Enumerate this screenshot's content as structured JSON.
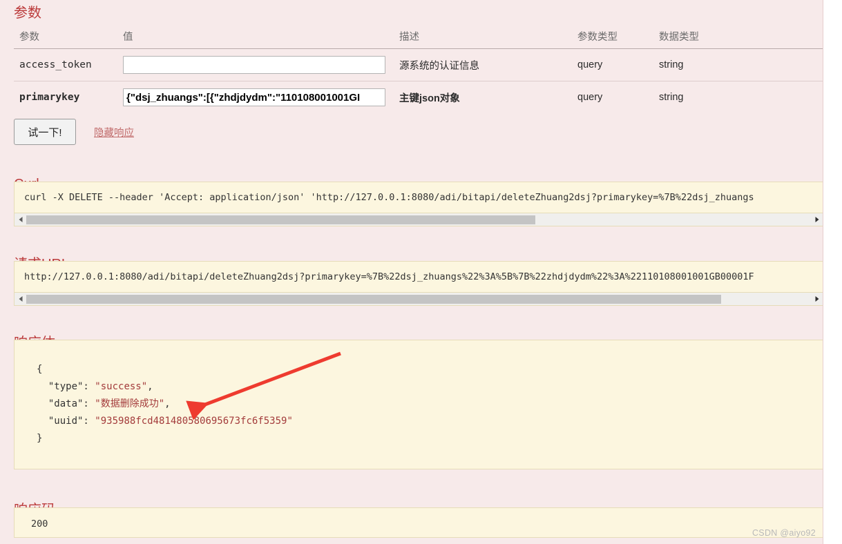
{
  "params_section": {
    "title": "参数",
    "columns": [
      "参数",
      "值",
      "描述",
      "参数类型",
      "数据类型"
    ],
    "rows": [
      {
        "name": "access_token",
        "value": "",
        "placeholder": "",
        "description": "源系统的认证信息",
        "param_type": "query",
        "data_type": "string",
        "required": false
      },
      {
        "name": "primarykey",
        "value": "{\"dsj_zhuangs\":[{\"zhdjdydm\":\"110108001001GI",
        "placeholder": "",
        "description": "主键json对象",
        "param_type": "query",
        "data_type": "string",
        "required": true
      }
    ]
  },
  "actions": {
    "try_button_label": "试一下!",
    "hide_response_label": "隐藏响应"
  },
  "curl_section": {
    "title": "Curl",
    "command": "curl -X DELETE --header 'Accept: application/json' 'http://127.0.0.1:8080/adi/bitapi/deleteZhuang2dsj?primarykey=%7B%22dsj_zhuangs"
  },
  "url_section": {
    "title": "请求URL",
    "url": "http://127.0.0.1:8080/adi/bitapi/deleteZhuang2dsj?primarykey=%7B%22dsj_zhuangs%22%3A%5B%7B%22zhdjdydm%22%3A%22110108001001GB00001F"
  },
  "response_body_section": {
    "title": "响应体",
    "lines": [
      {
        "indent": 0,
        "text": "{"
      },
      {
        "indent": 1,
        "key": "\"type\": ",
        "value": "\"success\"",
        "tail": ","
      },
      {
        "indent": 1,
        "key": "\"data\": ",
        "value": "\"数据删除成功\"",
        "tail": ","
      },
      {
        "indent": 1,
        "key": "\"uuid\": ",
        "value": "\"935988fcd481480580695673fc6f5359\"",
        "tail": ""
      },
      {
        "indent": 0,
        "text": "}"
      }
    ]
  },
  "response_code_section": {
    "title": "响应码",
    "code": "200"
  },
  "scrollbars": {
    "curl": {
      "left_arrow": "scroll-left-icon",
      "right_arrow": "scroll-right-icon",
      "thumb_start_pct": 2,
      "thumb_width_pct": 64
    },
    "url": {
      "left_arrow": "scroll-left-icon",
      "right_arrow": "scroll-right-icon",
      "thumb_start_pct": 2,
      "thumb_width_pct": 86
    }
  },
  "annotation": {
    "type": "arrow",
    "points_to": "data-value",
    "color": "#ee3b2f"
  },
  "watermark": "CSDN @aiyo92",
  "colors": {
    "panel_bg": "#f7eaea",
    "heading": "#bb3a3a",
    "code_bg": "#fcf6df",
    "code_border": "#e6dcb8",
    "json_string": "#a33b3b",
    "link": "#c06a6a",
    "arrow": "#ee3b2f"
  }
}
